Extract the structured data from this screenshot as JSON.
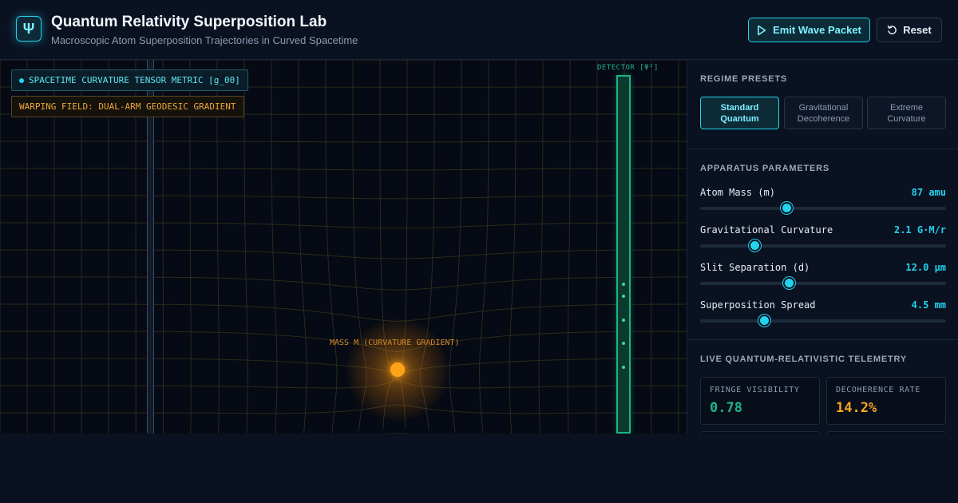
{
  "header": {
    "logo_glyph": "Ψ",
    "title": "Quantum Relativity Superposition Lab",
    "subtitle": "Macroscopic Atom Superposition Trajectories in Curved Spacetime",
    "emit_label": "Emit Wave Packet",
    "reset_label": "Reset",
    "emit_icon": "play-icon",
    "reset_icon": "rotate-ccw-icon"
  },
  "canvas": {
    "metric_tag": "SPACETIME CURVATURE TENSOR METRIC [g_00]",
    "warp_tag": "WARPING FIELD: DUAL-ARM GEODESIC GRADIENT",
    "detector_label": "DETECTOR [Ψ²]",
    "mass_label": "MASS M (CURVATURE GRADIENT)"
  },
  "presets": {
    "title": "REGIME PRESETS",
    "items": [
      {
        "label": "Standard Quantum",
        "active": true
      },
      {
        "label": "Gravitational Decoherence",
        "active": false
      },
      {
        "label": "Extreme Curvature",
        "active": false
      }
    ]
  },
  "params": {
    "title": "APPARATUS PARAMETERS",
    "items": [
      {
        "label": "Atom Mass (m)",
        "value": "87 amu",
        "level": 0.35
      },
      {
        "label": "Gravitational Curvature",
        "value": "2.1 G·M/r",
        "level": 0.22
      },
      {
        "label": "Slit Separation (d)",
        "value": "12.0 μm",
        "level": 0.36
      },
      {
        "label": "Superposition Spread",
        "value": "4.5 mm",
        "level": 0.26
      }
    ]
  },
  "telemetry": {
    "title": "LIVE QUANTUM-RELATIVISTIC TELEMETRY",
    "cards": [
      {
        "label": "FRINGE VISIBILITY",
        "value": "0.78",
        "color": "#1db386"
      },
      {
        "label": "DECOHERENCE RATE",
        "value": "14.2%",
        "color": "#f5a623"
      }
    ]
  },
  "colors": {
    "accent": "#22d3ee",
    "detector": "#1db386",
    "mass": "#ffa21a"
  }
}
